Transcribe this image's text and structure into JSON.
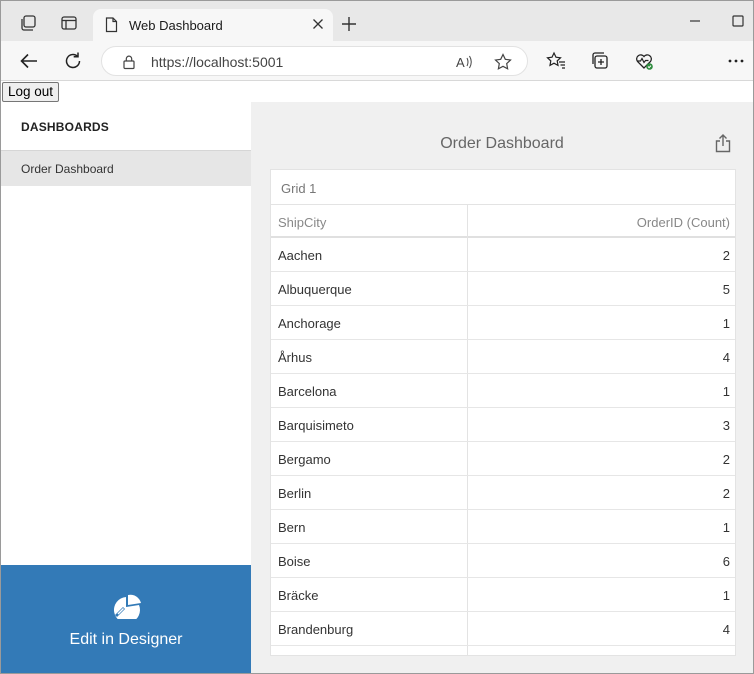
{
  "browser": {
    "tab_title": "Web Dashboard",
    "url": "https://localhost:5001"
  },
  "page": {
    "logout_label": "Log out",
    "sidebar": {
      "heading": "DASHBOARDS",
      "items": [
        {
          "label": "Order Dashboard"
        }
      ],
      "edit_label": "Edit in Designer"
    },
    "dashboard": {
      "title": "Order Dashboard",
      "grid": {
        "caption": "Grid 1",
        "columns": [
          "ShipCity",
          "OrderID (Count)"
        ],
        "rows": [
          {
            "city": "Aachen",
            "count": "2"
          },
          {
            "city": "Albuquerque",
            "count": "5"
          },
          {
            "city": "Anchorage",
            "count": "1"
          },
          {
            "city": "Århus",
            "count": "4"
          },
          {
            "city": "Barcelona",
            "count": "1"
          },
          {
            "city": "Barquisimeto",
            "count": "3"
          },
          {
            "city": "Bergamo",
            "count": "2"
          },
          {
            "city": "Berlin",
            "count": "2"
          },
          {
            "city": "Bern",
            "count": "1"
          },
          {
            "city": "Boise",
            "count": "6"
          },
          {
            "city": "Bräcke",
            "count": "1"
          },
          {
            "city": "Brandenburg",
            "count": "4"
          }
        ]
      }
    }
  },
  "colors": {
    "accent": "#337ab7",
    "main_bg": "#f0f0f0",
    "selected_item_bg": "#e6e6e6"
  },
  "icons": {
    "workspaces": "workspaces-icon",
    "tab_actions": "tab-actions-icon",
    "back": "back-arrow-icon",
    "refresh": "refresh-icon",
    "lock": "lock-icon",
    "read_aloud": "read-aloud-icon",
    "favorite": "star-icon",
    "favorites": "favorites-icon",
    "collections": "collections-icon",
    "browser_essentials": "heart-pulse-icon",
    "more": "more-icon",
    "export": "export-icon",
    "designer": "designer-icon"
  }
}
